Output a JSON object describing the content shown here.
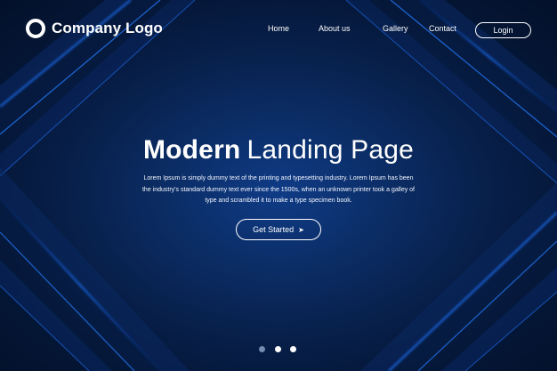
{
  "header": {
    "logo_text": "Company Logo",
    "nav": [
      "Home",
      "About us",
      "Gallery",
      "Contact"
    ],
    "login_label": "Login"
  },
  "hero": {
    "title_bold": "Modern",
    "title_light": "Landing Page",
    "description": "Lorem Ipsum is simply dummy text of the printing and typesetting industry. Lorem Ipsum has been the industry's standard dummy text ever since the 1500s, when an unknown printer took a galley of type and scrambled it to make a type specimen book.",
    "cta_label": "Get Started",
    "cta_icon": "➤"
  },
  "carousel": {
    "slide_count": 3,
    "active_slide": 1
  },
  "colors": {
    "background_dark": "#03102a",
    "background_center": "#0f3b86",
    "accent_line": "#1f6fe5",
    "text": "#ffffff"
  },
  "icons": {
    "logo": "ring-logo-icon",
    "cta": "arrow-right-icon"
  }
}
